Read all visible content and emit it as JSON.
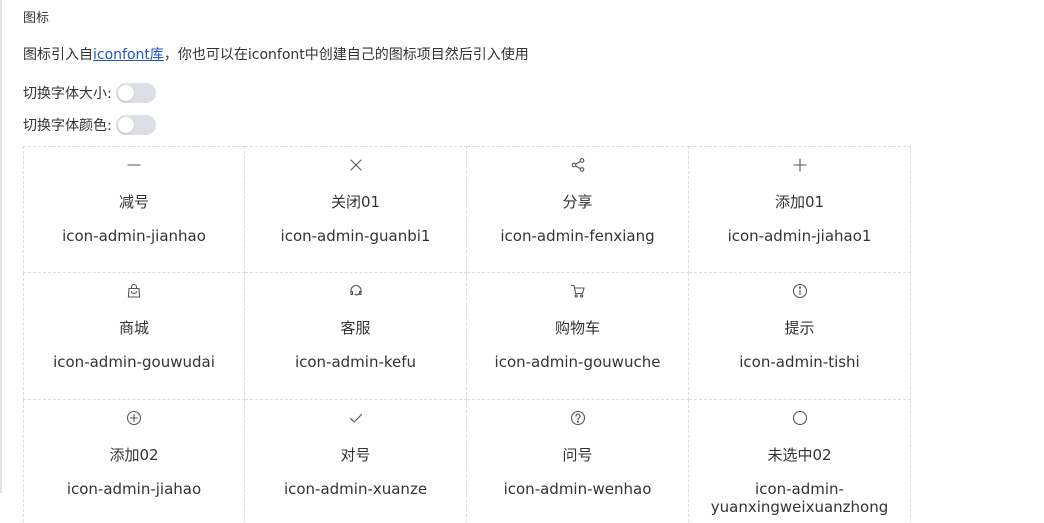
{
  "section_title": "图标",
  "intro": {
    "prefix": "图标引入自",
    "link": "iconfont库",
    "suffix": "，你也可以在iconfont中创建自己的图标项目然后引入使用"
  },
  "toggles": {
    "font_size_label": "切换字体大小:",
    "font_color_label": "切换字体颜色:"
  },
  "colors": {
    "link": "#2156c9",
    "switch_off": "#dcdfe6",
    "border": "#dcdcdc",
    "icon": "#555555"
  },
  "icons": [
    {
      "name": "减号",
      "code": "icon-admin-jianhao",
      "glyph": "minus-icon"
    },
    {
      "name": "关闭01",
      "code": "icon-admin-guanbi1",
      "glyph": "close-icon"
    },
    {
      "name": "分享",
      "code": "icon-admin-fenxiang",
      "glyph": "share-icon"
    },
    {
      "name": "添加01",
      "code": "icon-admin-jiahao1",
      "glyph": "plus-icon"
    },
    {
      "name": "商城",
      "code": "icon-admin-gouwudai",
      "glyph": "shopping-bag-icon"
    },
    {
      "name": "客服",
      "code": "icon-admin-kefu",
      "glyph": "customer-service-icon"
    },
    {
      "name": "购物车",
      "code": "icon-admin-gouwuche",
      "glyph": "cart-icon"
    },
    {
      "name": "提示",
      "code": "icon-admin-tishi",
      "glyph": "info-icon"
    },
    {
      "name": "添加02",
      "code": "icon-admin-jiahao",
      "glyph": "plus-circle-icon"
    },
    {
      "name": "对号",
      "code": "icon-admin-xuanze",
      "glyph": "check-icon"
    },
    {
      "name": "问号",
      "code": "icon-admin-wenhao",
      "glyph": "question-icon"
    },
    {
      "name": "未选中02",
      "code": "icon-admin-yuanxingweixuanzhong",
      "glyph": "circle-icon"
    }
  ]
}
